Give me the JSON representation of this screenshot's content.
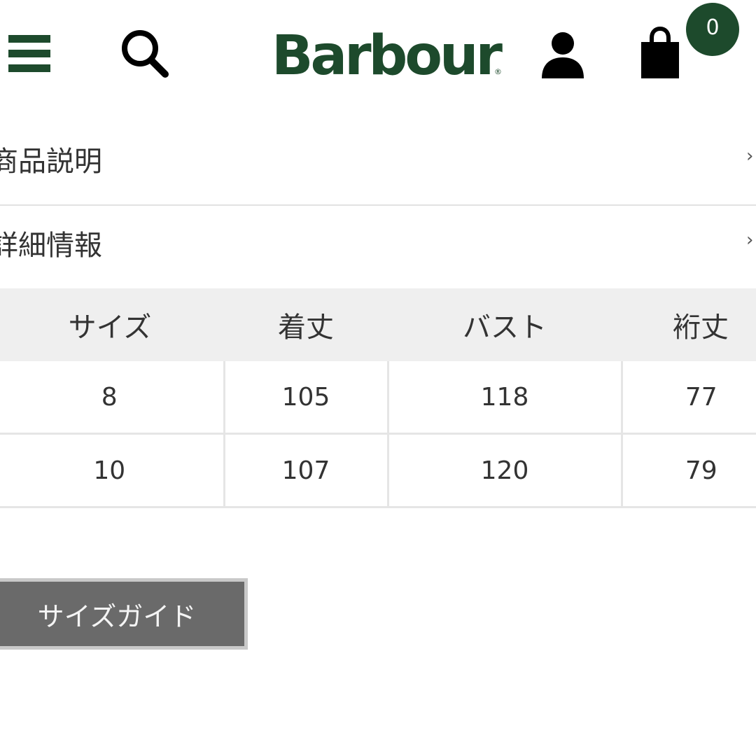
{
  "header": {
    "logo": "Barbour",
    "logo_mark": "®",
    "cart_count": "0",
    "icons": {
      "menu": "hamburger-menu-icon",
      "search": "search-icon",
      "account": "account-icon",
      "cart": "shopping-bag-icon"
    }
  },
  "accordions": [
    {
      "label": "商品説明",
      "chevron": "›"
    },
    {
      "label": "詳細情報",
      "chevron": "›"
    }
  ],
  "size_table": {
    "headers": [
      "サイズ",
      "着丈",
      "バスト",
      "裄丈"
    ],
    "rows": [
      [
        "8",
        "105",
        "118",
        "77"
      ],
      [
        "10",
        "107",
        "120",
        "79"
      ]
    ]
  },
  "size_guide": {
    "label": "サイズガイド"
  },
  "colors": {
    "brand": "#1d4a2c",
    "header_row_bg": "#efefef",
    "button_bg": "#6a6a6a"
  }
}
